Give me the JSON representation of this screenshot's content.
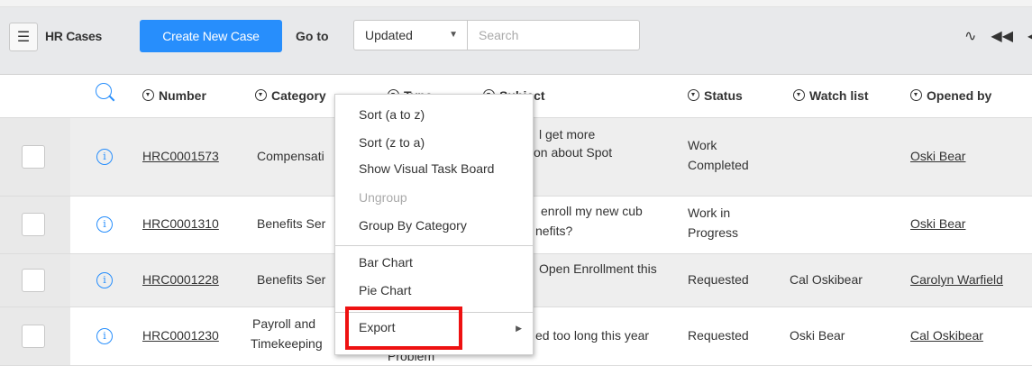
{
  "toolbar": {
    "title": "HR Cases",
    "create_label": "Create New Case",
    "goto_label": "Go to",
    "select_value": "Updated",
    "search_placeholder": "Search",
    "icons": [
      "pulse-icon",
      "rewind-icon",
      "prev-icon"
    ]
  },
  "columns": [
    "Number",
    "Category",
    "Type",
    "Subject",
    "Status",
    "Watch list",
    "Opened by"
  ],
  "rows": [
    {
      "number": "HRC0001573",
      "category": "Compensati",
      "subject1": "l get more",
      "subject2": "on about Spot",
      "status1": "Work",
      "status2": "Completed",
      "watch": "",
      "opened": "Oski Bear"
    },
    {
      "number": "HRC0001310",
      "category": "Benefits Ser",
      "subject1": "enroll my new cub",
      "subject2": "nefits?",
      "status1": "Work in",
      "status2": "Progress",
      "watch": "",
      "opened": "Oski Bear"
    },
    {
      "number": "HRC0001228",
      "category": "Benefits Ser",
      "subject1": "Open Enrollment this",
      "subject2": "",
      "status1": "Requested",
      "status2": "",
      "watch": "Cal Oskibear",
      "opened": "Carolyn Warfield"
    },
    {
      "number": "HRC0001230",
      "category1": "Payroll and",
      "category2": "Timekeeping",
      "type": "Problem",
      "subject1": "ed too long this year",
      "subject2": "",
      "status1": "Requested",
      "status2": "",
      "watch": "Oski Bear",
      "opened": "Cal Oskibear"
    }
  ],
  "menu": {
    "items": [
      "Sort (a to z)",
      "Sort (z to a)",
      "Show Visual Task Board",
      "Ungroup",
      "Group By Category",
      "Bar Chart",
      "Pie Chart",
      "Export"
    ],
    "disabled": [
      "Ungroup"
    ]
  },
  "colors": {
    "accent": "#278efc",
    "highlight": "#ee1111"
  }
}
